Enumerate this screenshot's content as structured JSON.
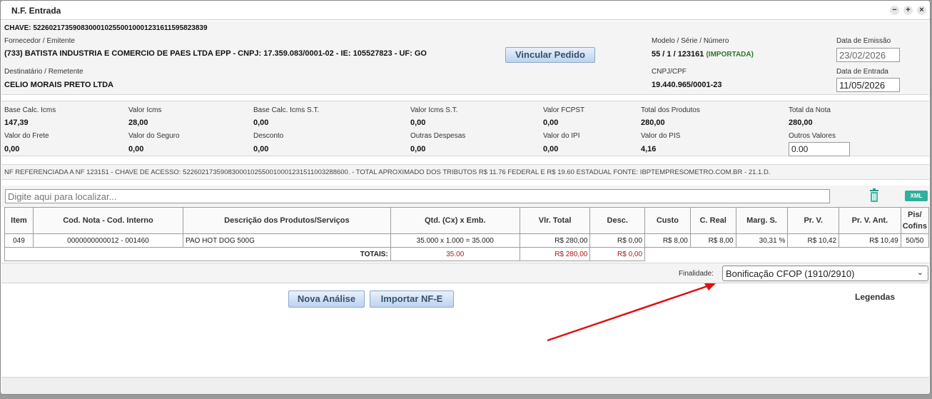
{
  "window": {
    "title": "N.F. Entrada"
  },
  "header": {
    "chave": "CHAVE: 52260217359083000102550010001231611595823839",
    "fornecedor_label": "Fornecedor / Emitente",
    "fornecedor_value": "(733) BATISTA INDUSTRIA E COMERCIO DE PAES LTDA EPP - CNPJ: 17.359.083/0001-02 - IE: 105527823 - UF: GO",
    "vincular_btn": "Vincular Pedido",
    "modelo_label": "Modelo / Série / Número",
    "modelo_value": "55 / 1 / 123161",
    "modelo_status": "(IMPORTADA)",
    "emissao_label": "Data de Emissão",
    "emissao_value": "23/02/2026",
    "destinatario_label": "Destinatário / Remetente",
    "destinatario_value": "CELIO MORAIS PRETO LTDA",
    "cnpj_label": "CNPJ/CPF",
    "cnpj_value": "19.440.965/0001-23",
    "entrada_label": "Data de Entrada",
    "entrada_value": "11/05/2026"
  },
  "totals": {
    "base_icms_label": "Base Calc. Icms",
    "base_icms": "147,39",
    "valor_icms_label": "Valor Icms",
    "valor_icms": "28,00",
    "base_st_label": "Base Calc. Icms S.T.",
    "base_st": "0,00",
    "valor_st_label": "Valor Icms S.T.",
    "valor_st": "0,00",
    "fcpst_label": "Valor FCPST",
    "fcpst": "0,00",
    "total_prod_label": "Total dos Produtos",
    "total_prod": "280,00",
    "total_nota_label": "Total da Nota",
    "total_nota": "280,00",
    "frete_label": "Valor do Frete",
    "frete": "0,00",
    "seguro_label": "Valor do Seguro",
    "seguro": "0,00",
    "desconto_label": "Desconto",
    "desconto": "0,00",
    "outras_label": "Outras Despesas",
    "outras": "0,00",
    "ipi_label": "Valor do IPI",
    "ipi": "0,00",
    "pis_label": "Valor do PIS",
    "pis": "4,16",
    "outros_valores_label": "Outros Valores",
    "outros_valores": "0.00"
  },
  "observacao": "NF REFERENCIADA A NF 123151 - CHAVE DE ACESSO: 52260217359083000102550010001231511003288600. - TOTAL APROXIMADO DOS TRIBUTOS R$ 11.76 FEDERAL E R$ 19.60 ESTADUAL FONTE: IBPTEMPRESOMETRO.COM.BR - 21.1.D.",
  "search": {
    "placeholder": "Digite aqui para localizar...",
    "xml_btn": "XML"
  },
  "table": {
    "headers": [
      "Item",
      "Cod. Nota - Cod. Interno",
      "Descrição dos Produtos/Serviços",
      "Qtd. (Cx) x Emb.",
      "Vlr. Total",
      "Desc.",
      "Custo",
      "C. Real",
      "Marg. S.",
      "Pr. V.",
      "Pr. V. Ant.",
      "Pis/ Cofins"
    ],
    "rows": [
      [
        "049",
        "0000000000012 - 001460",
        "PAO HOT DOG 500G",
        "35.000 x 1.000 = 35.000",
        "R$ 280,00",
        "R$ 0,00",
        "R$ 8,00",
        "R$ 8,00",
        "30,31 %",
        "R$ 10,42",
        "R$ 10,49",
        "50/50"
      ]
    ],
    "totals_label": "TOTAIS:",
    "totals_qtd": "35.00",
    "totals_vlr": "R$ 280,00",
    "totals_desc": "R$ 0,00"
  },
  "finalidade": {
    "label": "Finalidade:",
    "value": "Bonificação CFOP (1910/2910)"
  },
  "actions": {
    "nova_analise": "Nova Análise",
    "importar": "Importar NF-E",
    "legendas": "Legendas"
  }
}
